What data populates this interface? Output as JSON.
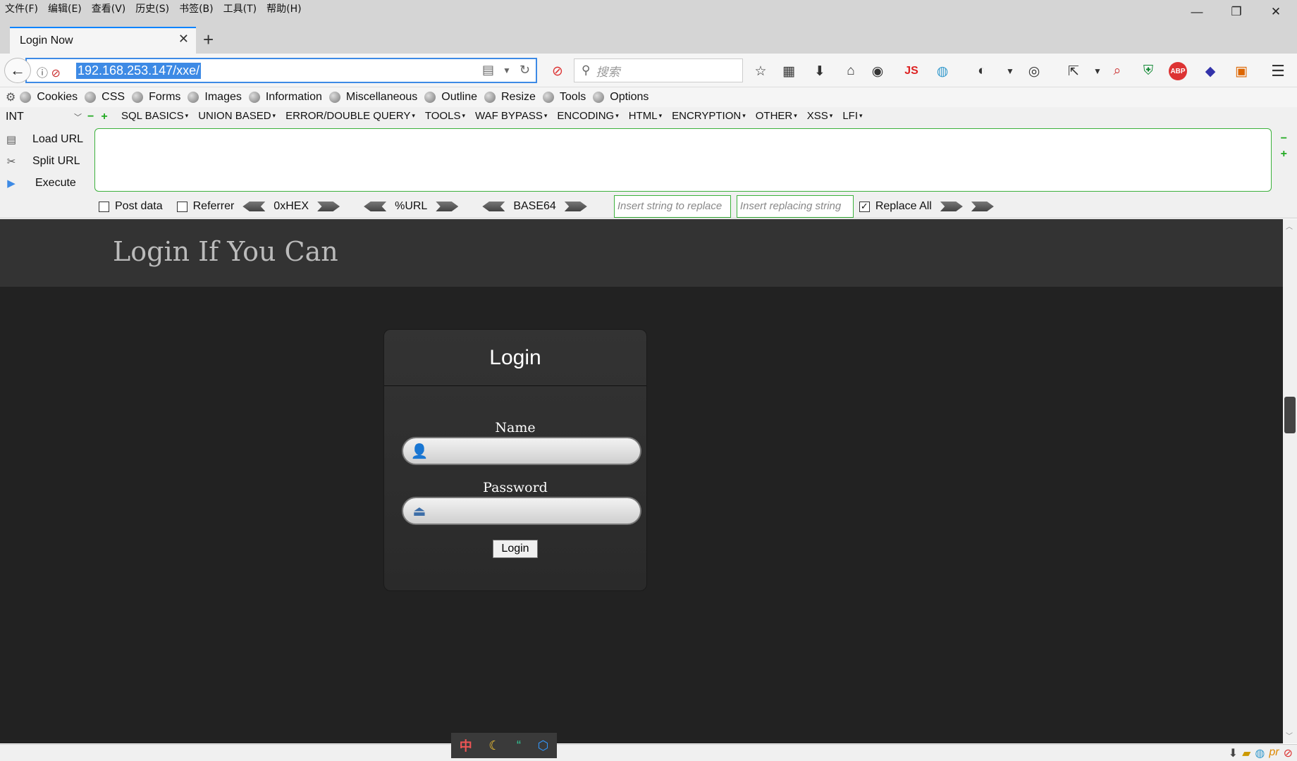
{
  "menubar": {
    "items": [
      "文件(F)",
      "编辑(E)",
      "查看(V)",
      "历史(S)",
      "书签(B)",
      "工具(T)",
      "帮助(H)"
    ]
  },
  "tab": {
    "title": "Login Now"
  },
  "navbar": {
    "url": "192.168.253.147/xxe/",
    "search_placeholder": "搜索",
    "js_label": "JS",
    "abp_label": "ABP"
  },
  "bookmarks": [
    "Cookies",
    "CSS",
    "Forms",
    "Images",
    "Information",
    "Miscellaneous",
    "Outline",
    "Resize",
    "Tools",
    "Options"
  ],
  "hackbar": {
    "select_value": "INT",
    "menus": [
      "SQL BASICS",
      "UNION BASED",
      "ERROR/DOUBLE QUERY",
      "TOOLS",
      "WAF BYPASS",
      "ENCODING",
      "HTML",
      "ENCRYPTION",
      "OTHER",
      "XSS",
      "LFI"
    ],
    "actions": {
      "load": "Load URL",
      "split": "Split URL",
      "execute": "Execute"
    },
    "post_data": "Post data",
    "referrer": "Referrer",
    "hex": "0xHEX",
    "url_enc": "%URL",
    "base64": "BASE64",
    "replace_placeholder": "Insert string to replace",
    "replacing_placeholder": "Insert replacing string",
    "replace_all": "Replace All"
  },
  "page": {
    "title": "Login If You Can",
    "card_title": "Login",
    "name_label": "Name",
    "password_label": "Password",
    "button": "Login"
  },
  "ime": {
    "lang": "中"
  }
}
